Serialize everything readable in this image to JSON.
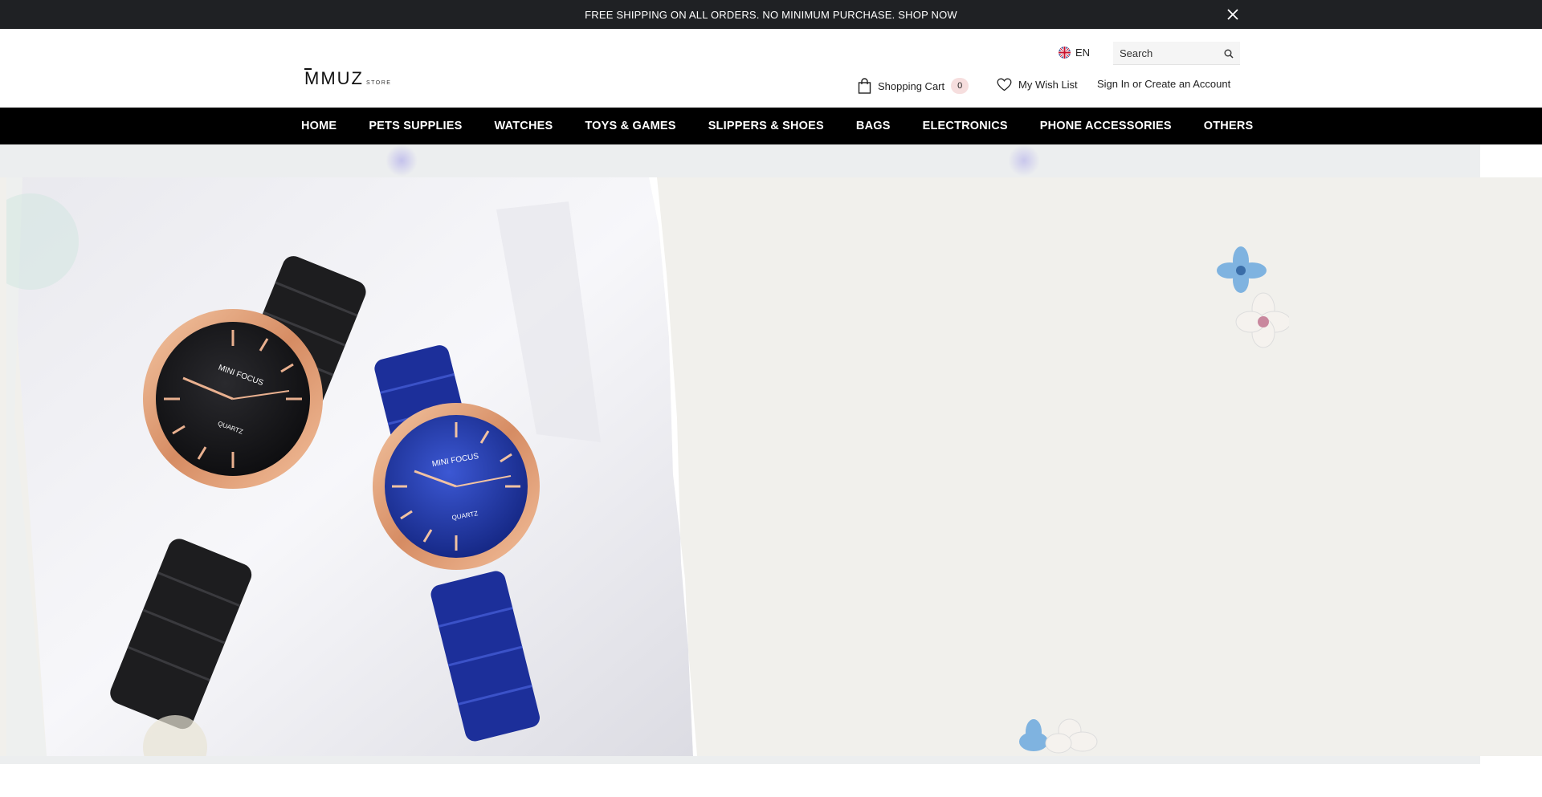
{
  "announcement": {
    "text": "FREE SHIPPING ON ALL ORDERS. NO MINIMUM PURCHASE. SHOP NOW"
  },
  "header": {
    "logo": {
      "wordmark": "MMUZ",
      "suffix": "STORE"
    },
    "language": "EN",
    "search": {
      "placeholder": "Search"
    },
    "cart": {
      "label": "Shopping Cart",
      "count": "0"
    },
    "wishlist": {
      "label": "My Wish List"
    },
    "account": {
      "label": "Sign In or Create an Account"
    }
  },
  "nav": {
    "items": [
      "HOME",
      "PETS SUPPLIES",
      "WATCHES",
      "TOYS & GAMES",
      "SLIPPERS & SHOES",
      "BAGS",
      "ELECTRONICS",
      "PHONE ACCESSORIES",
      "OTHERS"
    ]
  },
  "hero": {
    "watch_brand": "MINI FOCUS",
    "watch_type": "QUARTZ"
  },
  "colors": {
    "announce_bg": "#1f2124",
    "nav_bg": "#000000",
    "hero_bg": "#f1f0ec",
    "cart_badge": "#f6dede"
  }
}
